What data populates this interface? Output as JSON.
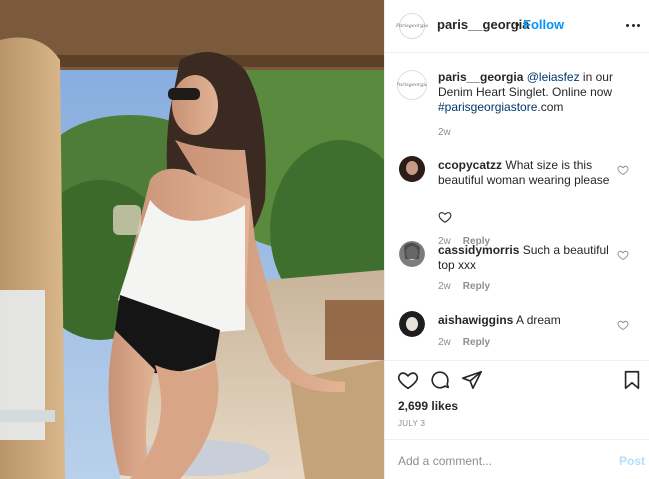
{
  "post": {
    "username": "paris__georgia",
    "dot": "•",
    "follow_label": "Follow",
    "logo_text": "Parisgeorgia"
  },
  "caption": {
    "username": "paris__georgia",
    "mention": "@leiasfez",
    "text_mid": " in our Denim Heart Singlet. Online now ",
    "hashtag": "#parisgeorgiastore",
    "text_end": ".com",
    "age": "2w"
  },
  "comments": [
    {
      "username": "ccopycatzz",
      "text": "What size is this beautiful woman wearing please",
      "age": "2w",
      "reply": "Reply",
      "avatar_color": "#5a3b2e"
    },
    {
      "username": "cassidymorris",
      "text": "Such a beautiful top xxx",
      "age": "2w",
      "reply": "Reply",
      "avatar_color": "#6a6a6a"
    },
    {
      "username": "aishawiggins",
      "text": "A dream",
      "age": "2w",
      "reply": "Reply",
      "avatar_color": "#2b2b2b"
    }
  ],
  "actions": {
    "likes": "2,699 likes",
    "date": "JULY 3",
    "comment_placeholder": "Add a comment...",
    "post_label": "Post"
  },
  "colors": {
    "follow": "#0095f6",
    "link": "#00376b",
    "muted": "#8e8e8e"
  }
}
